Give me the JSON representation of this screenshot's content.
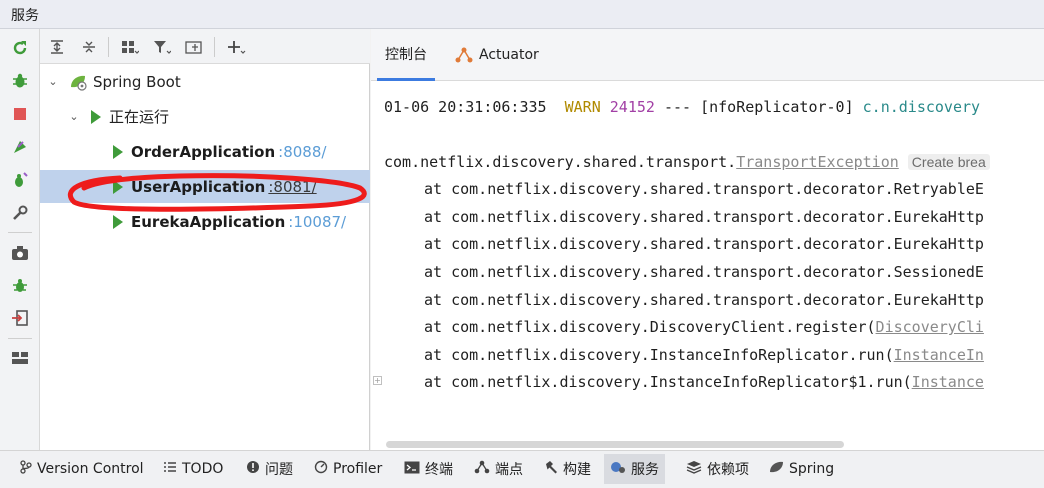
{
  "title": "服务",
  "left_toolbar": {
    "icons": [
      "rerun-icon",
      "debug-icon",
      "stop-icon",
      "run-config-icon",
      "debug-config-icon",
      "wrench-icon",
      "camera-icon",
      "bug-icon",
      "exit-icon",
      "layout-icon"
    ]
  },
  "tree_toolbar": {
    "icons": [
      "expand-all-icon",
      "collapse-all-icon",
      "group-icon",
      "filter-icon",
      "new-tab-icon",
      "add-icon"
    ]
  },
  "tree": {
    "root": {
      "label": "Spring Boot"
    },
    "group": {
      "label": "正在运行"
    },
    "apps": [
      {
        "name": "OrderApplication",
        "port": ":8088/"
      },
      {
        "name": "UserApplication",
        "port": ":8081/"
      },
      {
        "name": "EurekaApplication",
        "port": ":10087/"
      }
    ]
  },
  "console_tabs": [
    {
      "label": "控制台"
    },
    {
      "label": "Actuator"
    }
  ],
  "console": {
    "log_line": {
      "timestamp": "01-06 20:31:06:335",
      "level": "WARN",
      "pid": "24152",
      "sep": "---",
      "thread": "[nfoReplicator-0]",
      "logger": "c.n.discovery"
    },
    "exception": {
      "prefix": "com.netflix.discovery.shared.transport.",
      "link": "TransportException",
      "hint": "Create brea"
    },
    "stack": [
      {
        "text": "at com.netflix.discovery.shared.transport.decorator.RetryableE",
        "link": ""
      },
      {
        "text": "at com.netflix.discovery.shared.transport.decorator.EurekaHttp",
        "link": ""
      },
      {
        "text": "at com.netflix.discovery.shared.transport.decorator.EurekaHttp",
        "link": ""
      },
      {
        "text": "at com.netflix.discovery.shared.transport.decorator.SessionedE",
        "link": ""
      },
      {
        "text": "at com.netflix.discovery.shared.transport.decorator.EurekaHttp",
        "link": ""
      },
      {
        "text": "at com.netflix.discovery.DiscoveryClient.register(",
        "link": "DiscoveryCli"
      },
      {
        "text": "at com.netflix.discovery.InstanceInfoReplicator.run(",
        "link": "InstanceIn"
      },
      {
        "text": "at com.netflix.discovery.InstanceInfoReplicator$1.run(",
        "link": "Instance"
      }
    ]
  },
  "bottom_bar": [
    {
      "label": "Version Control",
      "icon": "branch-icon"
    },
    {
      "label": "TODO",
      "icon": "list-icon"
    },
    {
      "label": "问题",
      "icon": "info-icon"
    },
    {
      "label": "Profiler",
      "icon": "profiler-icon"
    },
    {
      "label": "终端",
      "icon": "terminal-icon"
    },
    {
      "label": "端点",
      "icon": "endpoints-icon"
    },
    {
      "label": "构建",
      "icon": "hammer-icon"
    },
    {
      "label": "服务",
      "icon": "services-icon"
    },
    {
      "label": "依赖项",
      "icon": "layers-icon"
    },
    {
      "label": "Spring",
      "icon": "spring-icon"
    }
  ],
  "colors": {
    "selection": "#bfd2ec",
    "run_green": "#3f9b3a",
    "port_blue": "#5c9dd6",
    "warn": "#b08a00",
    "pid": "#a23fa5",
    "annotation_red": "#ee1c1c"
  }
}
